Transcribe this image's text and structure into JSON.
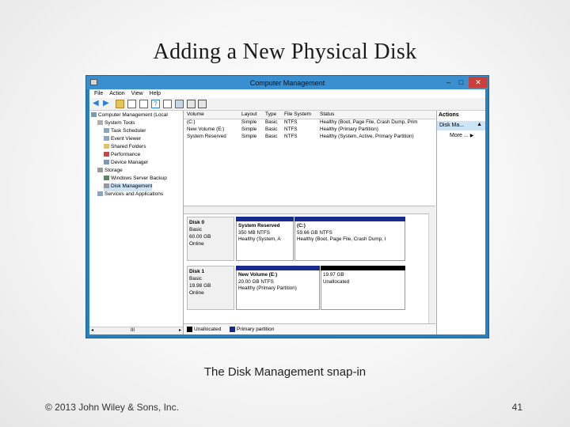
{
  "slide": {
    "title": "Adding a New Physical Disk",
    "caption": "The Disk Management snap-in",
    "copyright": "© 2013 John Wiley & Sons, Inc.",
    "page_number": "41"
  },
  "window": {
    "title": "Computer Management",
    "minimize": "–",
    "maximize": "□",
    "close": "✕",
    "menu": [
      "File",
      "Action",
      "View",
      "Help"
    ]
  },
  "tree": {
    "root": "Computer Management (Local",
    "items": [
      "System Tools",
      "Task Scheduler",
      "Event Viewer",
      "Shared Folders",
      "Performance",
      "Device Manager",
      "Storage",
      "Windows Server Backup",
      "Disk Management",
      "Services and Applications"
    ],
    "scroll_label": "III"
  },
  "volumes": {
    "headers": [
      "Volume",
      "Layout",
      "Type",
      "File System",
      "Status"
    ],
    "rows": [
      [
        "(C:)",
        "Simple",
        "Basic",
        "NTFS",
        "Healthy (Boot, Page File, Crash Dump, Prim"
      ],
      [
        "New Volume (E:)",
        "Simple",
        "Basic",
        "NTFS",
        "Healthy (Primary Partition)"
      ],
      [
        "System Reserved",
        "Simple",
        "Basic",
        "NTFS",
        "Healthy (System, Active, Primary Partition)"
      ]
    ]
  },
  "disks": [
    {
      "name": "Disk 0",
      "type": "Basic",
      "size": "60.00 GB",
      "state": "Online",
      "partitions": [
        {
          "name": "System Reserved",
          "size": "350 MB NTFS",
          "status": "Healthy (System, A",
          "bar_color": "#1a2a8c"
        },
        {
          "name": "(C:)",
          "size": "59.66 GB NTFS",
          "status": "Healthy (Boot, Page File, Crash Dump, I",
          "bar_color": "#1a2a8c"
        }
      ]
    },
    {
      "name": "Disk 1",
      "type": "Basic",
      "size": "19.98 GB",
      "state": "Online",
      "partitions": [
        {
          "name": "New Volume (E:)",
          "size": "20.00 GB NTFS",
          "status": "Healthy (Primary Partition)",
          "bar_color": "#1a2a8c"
        },
        {
          "name": "",
          "size": "19.97 GB",
          "status": "Unallocated",
          "bar_color": "#000000"
        }
      ]
    }
  ],
  "legend": {
    "unallocated": "Unallocated",
    "primary": "Primary partition",
    "unallocated_color": "#000000",
    "primary_color": "#1a2a8c"
  },
  "actions": {
    "header": "Actions",
    "selected": "Disk Ma...",
    "more": "More ..."
  }
}
